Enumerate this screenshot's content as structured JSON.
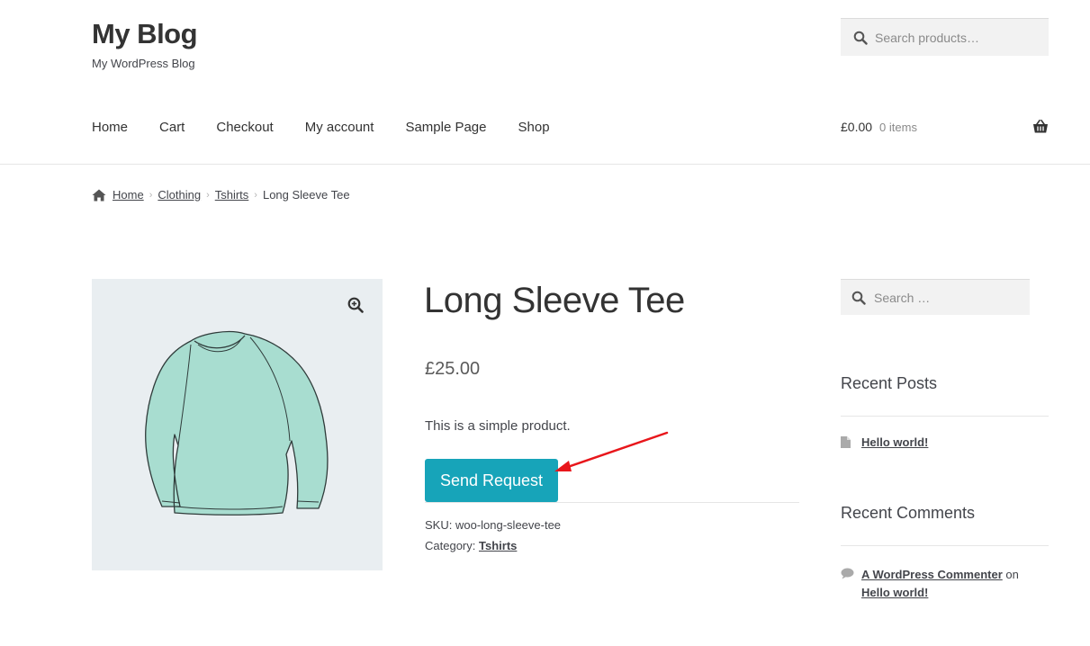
{
  "site": {
    "title": "My Blog",
    "description": "My WordPress Blog"
  },
  "header_search": {
    "placeholder": "Search products…"
  },
  "nav": {
    "items": [
      "Home",
      "Cart",
      "Checkout",
      "My account",
      "Sample Page",
      "Shop"
    ]
  },
  "cart": {
    "amount": "£0.00",
    "count": "0 items"
  },
  "breadcrumb": {
    "items": [
      "Home",
      "Clothing",
      "Tshirts"
    ],
    "current": "Long Sleeve Tee"
  },
  "product": {
    "title": "Long Sleeve Tee",
    "price": "£25.00",
    "short_description": "This is a simple product.",
    "button_label": "Send Request",
    "sku_label": "SKU:",
    "sku": "woo-long-sleeve-tee",
    "category_label": "Category:",
    "category": "Tshirts"
  },
  "sidebar": {
    "search_placeholder": "Search …",
    "recent_posts_title": "Recent Posts",
    "recent_posts": [
      "Hello world!"
    ],
    "recent_comments_title": "Recent Comments",
    "comment_author": "A WordPress Commenter",
    "comment_on": "on",
    "comment_post": "Hello world!"
  },
  "colors": {
    "button": "#17a4b9",
    "annotation_arrow": "#e8161b",
    "image_bg": "#e9eef1"
  },
  "icons": {
    "search": "search-icon",
    "basket": "basket-icon",
    "home": "home-icon",
    "zoom": "zoom-in-icon",
    "document": "document-icon",
    "comment": "comment-bubble-icon"
  }
}
